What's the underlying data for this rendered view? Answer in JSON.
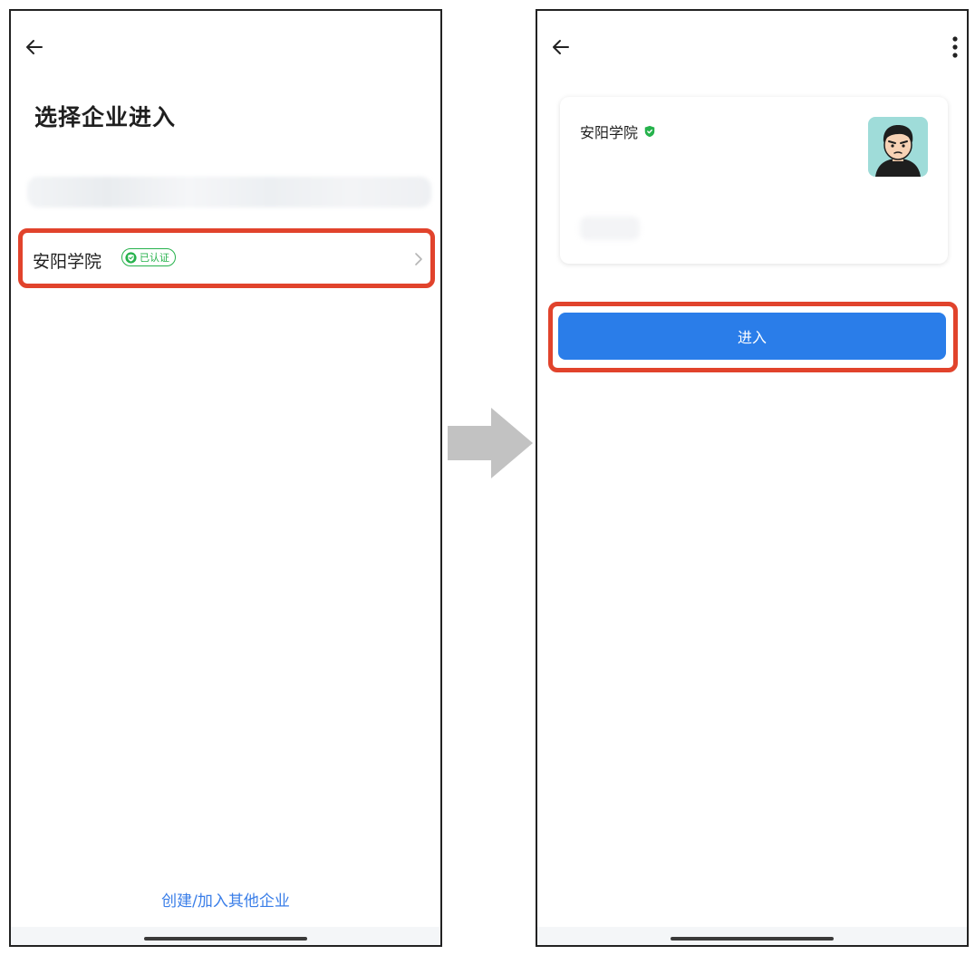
{
  "left_screen": {
    "title": "选择企业进入",
    "org_row": {
      "name": "安阳学院",
      "badge": "已认证"
    },
    "footer_link": "创建/加入其他企业"
  },
  "right_screen": {
    "card": {
      "org_name": "安阳学院"
    },
    "enter_button": "进入"
  },
  "colors": {
    "accent_blue": "#2a7de9",
    "verified_green": "#26b24c",
    "highlight_red": "#e1432c",
    "link_blue": "#3a7ee8"
  },
  "icons": [
    "back-arrow-icon",
    "chevron-right-icon",
    "shield-check-icon",
    "more-vertical-icon",
    "avatar-icon",
    "transition-arrow-icon"
  ]
}
